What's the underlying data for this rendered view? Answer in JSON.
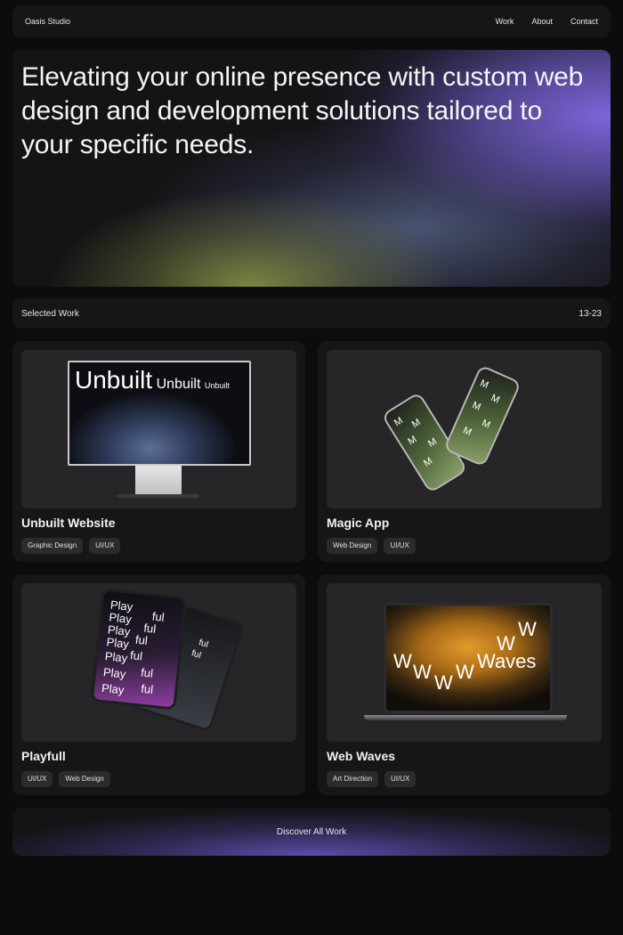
{
  "nav": {
    "brand": "Oasis Studio",
    "links": [
      "Work",
      "About",
      "Contact"
    ]
  },
  "hero": {
    "headline": "Elevating your online presence with custom web design and development solutions tailored to your specific needs."
  },
  "selected": {
    "label": "Selected Work",
    "range": "13-23"
  },
  "projects": [
    {
      "title": "Unbuilt Website",
      "tags": [
        "Graphic Design",
        "UI/UX"
      ],
      "screen_text": [
        "Unbuilt",
        "Unbuilt",
        "Unbuilt"
      ]
    },
    {
      "title": "Magic App",
      "tags": [
        "Web Design",
        "UI/UX"
      ],
      "screen_text": "M"
    },
    {
      "title": "Playfull",
      "tags": [
        "UI/UX",
        "Web Design"
      ],
      "screen_text": [
        "Play",
        "ful"
      ]
    },
    {
      "title": "Web Waves",
      "tags": [
        "Art Direction",
        "UI/UX"
      ],
      "screen_text": [
        "W",
        "Waves"
      ]
    }
  ],
  "cta": {
    "label": "Discover All Work"
  },
  "colors": {
    "background": "#0c0c0d",
    "panel": "#161617",
    "accent_purple": "#846ae6",
    "accent_olive": "#8c9646",
    "accent_orange": "#e39b2e"
  }
}
